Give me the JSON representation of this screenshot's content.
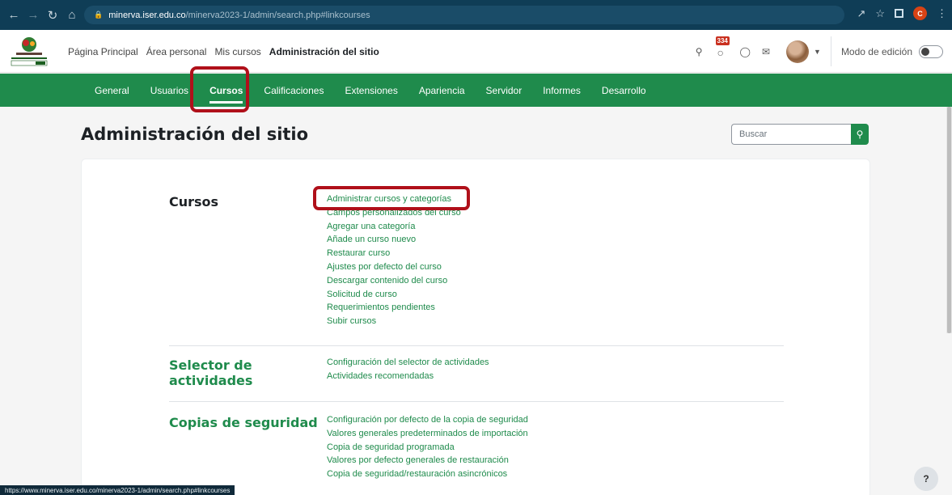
{
  "browser": {
    "url_host": "minerva.iser.edu.co",
    "url_path": "/minerva2023-1/admin/search.php#linkcourses",
    "profile_initial": "C",
    "status_url": "https://www.minerva.iser.edu.co/minerva2023-1/admin/search.php#linkcourses"
  },
  "header": {
    "primary_nav": [
      "Página Principal",
      "Área personal",
      "Mis cursos",
      "Administración del sitio"
    ],
    "notification_count": "334",
    "edit_mode_label": "Modo de edición"
  },
  "secondary_nav": [
    "General",
    "Usuarios",
    "Cursos",
    "Calificaciones",
    "Extensiones",
    "Apariencia",
    "Servidor",
    "Informes",
    "Desarrollo"
  ],
  "page": {
    "title": "Administración del sitio",
    "search_placeholder": "Buscar"
  },
  "sections": [
    {
      "title": "Cursos",
      "links": [
        "Administrar cursos y categorías",
        "Campos personalizados del curso",
        "Agregar una categoría",
        "Añade un curso nuevo",
        "Restaurar curso",
        "Ajustes por defecto del curso",
        "Descargar contenido del curso",
        "Solicitud de curso",
        "Requerimientos pendientes",
        "Subir cursos"
      ]
    },
    {
      "title": "Selector de actividades",
      "links": [
        "Configuración del selector de actividades",
        "Actividades recomendadas"
      ]
    },
    {
      "title": "Copias de seguridad",
      "links": [
        "Configuración por defecto de la copia de seguridad",
        "Valores generales predeterminados de importación",
        "Copia de seguridad programada",
        "Valores por defecto generales de restauración",
        "Copia de seguridad/restauración asincrónicos"
      ]
    }
  ],
  "help_label": "?",
  "colors": {
    "brand_green": "#1f8b4c",
    "highlight_red": "#b0101a",
    "chrome_blue": "#0f3d56"
  }
}
